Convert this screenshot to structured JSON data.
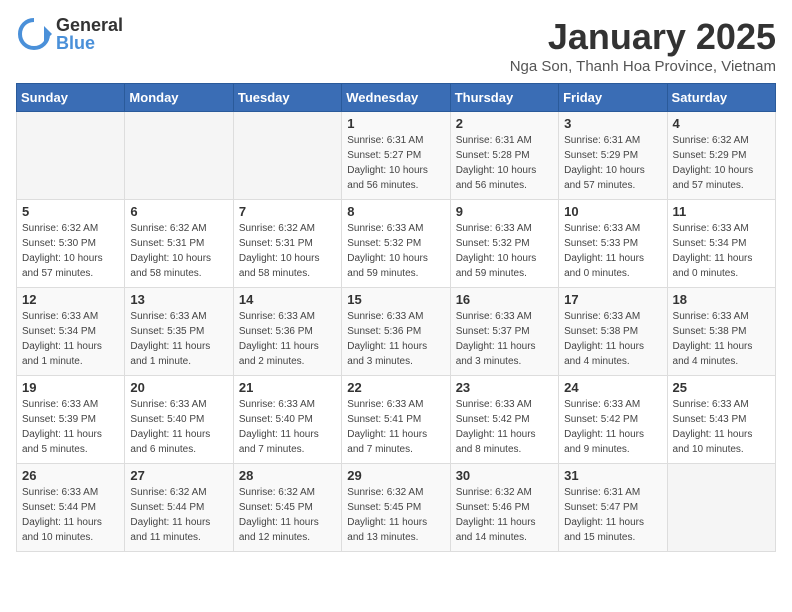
{
  "logo": {
    "general": "General",
    "blue": "Blue"
  },
  "title": "January 2025",
  "subtitle": "Nga Son, Thanh Hoa Province, Vietnam",
  "headers": [
    "Sunday",
    "Monday",
    "Tuesday",
    "Wednesday",
    "Thursday",
    "Friday",
    "Saturday"
  ],
  "weeks": [
    [
      {
        "day": "",
        "info": ""
      },
      {
        "day": "",
        "info": ""
      },
      {
        "day": "",
        "info": ""
      },
      {
        "day": "1",
        "info": "Sunrise: 6:31 AM\nSunset: 5:27 PM\nDaylight: 10 hours\nand 56 minutes."
      },
      {
        "day": "2",
        "info": "Sunrise: 6:31 AM\nSunset: 5:28 PM\nDaylight: 10 hours\nand 56 minutes."
      },
      {
        "day": "3",
        "info": "Sunrise: 6:31 AM\nSunset: 5:29 PM\nDaylight: 10 hours\nand 57 minutes."
      },
      {
        "day": "4",
        "info": "Sunrise: 6:32 AM\nSunset: 5:29 PM\nDaylight: 10 hours\nand 57 minutes."
      }
    ],
    [
      {
        "day": "5",
        "info": "Sunrise: 6:32 AM\nSunset: 5:30 PM\nDaylight: 10 hours\nand 57 minutes."
      },
      {
        "day": "6",
        "info": "Sunrise: 6:32 AM\nSunset: 5:31 PM\nDaylight: 10 hours\nand 58 minutes."
      },
      {
        "day": "7",
        "info": "Sunrise: 6:32 AM\nSunset: 5:31 PM\nDaylight: 10 hours\nand 58 minutes."
      },
      {
        "day": "8",
        "info": "Sunrise: 6:33 AM\nSunset: 5:32 PM\nDaylight: 10 hours\nand 59 minutes."
      },
      {
        "day": "9",
        "info": "Sunrise: 6:33 AM\nSunset: 5:32 PM\nDaylight: 10 hours\nand 59 minutes."
      },
      {
        "day": "10",
        "info": "Sunrise: 6:33 AM\nSunset: 5:33 PM\nDaylight: 11 hours\nand 0 minutes."
      },
      {
        "day": "11",
        "info": "Sunrise: 6:33 AM\nSunset: 5:34 PM\nDaylight: 11 hours\nand 0 minutes."
      }
    ],
    [
      {
        "day": "12",
        "info": "Sunrise: 6:33 AM\nSunset: 5:34 PM\nDaylight: 11 hours\nand 1 minute."
      },
      {
        "day": "13",
        "info": "Sunrise: 6:33 AM\nSunset: 5:35 PM\nDaylight: 11 hours\nand 1 minute."
      },
      {
        "day": "14",
        "info": "Sunrise: 6:33 AM\nSunset: 5:36 PM\nDaylight: 11 hours\nand 2 minutes."
      },
      {
        "day": "15",
        "info": "Sunrise: 6:33 AM\nSunset: 5:36 PM\nDaylight: 11 hours\nand 3 minutes."
      },
      {
        "day": "16",
        "info": "Sunrise: 6:33 AM\nSunset: 5:37 PM\nDaylight: 11 hours\nand 3 minutes."
      },
      {
        "day": "17",
        "info": "Sunrise: 6:33 AM\nSunset: 5:38 PM\nDaylight: 11 hours\nand 4 minutes."
      },
      {
        "day": "18",
        "info": "Sunrise: 6:33 AM\nSunset: 5:38 PM\nDaylight: 11 hours\nand 4 minutes."
      }
    ],
    [
      {
        "day": "19",
        "info": "Sunrise: 6:33 AM\nSunset: 5:39 PM\nDaylight: 11 hours\nand 5 minutes."
      },
      {
        "day": "20",
        "info": "Sunrise: 6:33 AM\nSunset: 5:40 PM\nDaylight: 11 hours\nand 6 minutes."
      },
      {
        "day": "21",
        "info": "Sunrise: 6:33 AM\nSunset: 5:40 PM\nDaylight: 11 hours\nand 7 minutes."
      },
      {
        "day": "22",
        "info": "Sunrise: 6:33 AM\nSunset: 5:41 PM\nDaylight: 11 hours\nand 7 minutes."
      },
      {
        "day": "23",
        "info": "Sunrise: 6:33 AM\nSunset: 5:42 PM\nDaylight: 11 hours\nand 8 minutes."
      },
      {
        "day": "24",
        "info": "Sunrise: 6:33 AM\nSunset: 5:42 PM\nDaylight: 11 hours\nand 9 minutes."
      },
      {
        "day": "25",
        "info": "Sunrise: 6:33 AM\nSunset: 5:43 PM\nDaylight: 11 hours\nand 10 minutes."
      }
    ],
    [
      {
        "day": "26",
        "info": "Sunrise: 6:33 AM\nSunset: 5:44 PM\nDaylight: 11 hours\nand 10 minutes."
      },
      {
        "day": "27",
        "info": "Sunrise: 6:32 AM\nSunset: 5:44 PM\nDaylight: 11 hours\nand 11 minutes."
      },
      {
        "day": "28",
        "info": "Sunrise: 6:32 AM\nSunset: 5:45 PM\nDaylight: 11 hours\nand 12 minutes."
      },
      {
        "day": "29",
        "info": "Sunrise: 6:32 AM\nSunset: 5:45 PM\nDaylight: 11 hours\nand 13 minutes."
      },
      {
        "day": "30",
        "info": "Sunrise: 6:32 AM\nSunset: 5:46 PM\nDaylight: 11 hours\nand 14 minutes."
      },
      {
        "day": "31",
        "info": "Sunrise: 6:31 AM\nSunset: 5:47 PM\nDaylight: 11 hours\nand 15 minutes."
      },
      {
        "day": "",
        "info": ""
      }
    ]
  ]
}
